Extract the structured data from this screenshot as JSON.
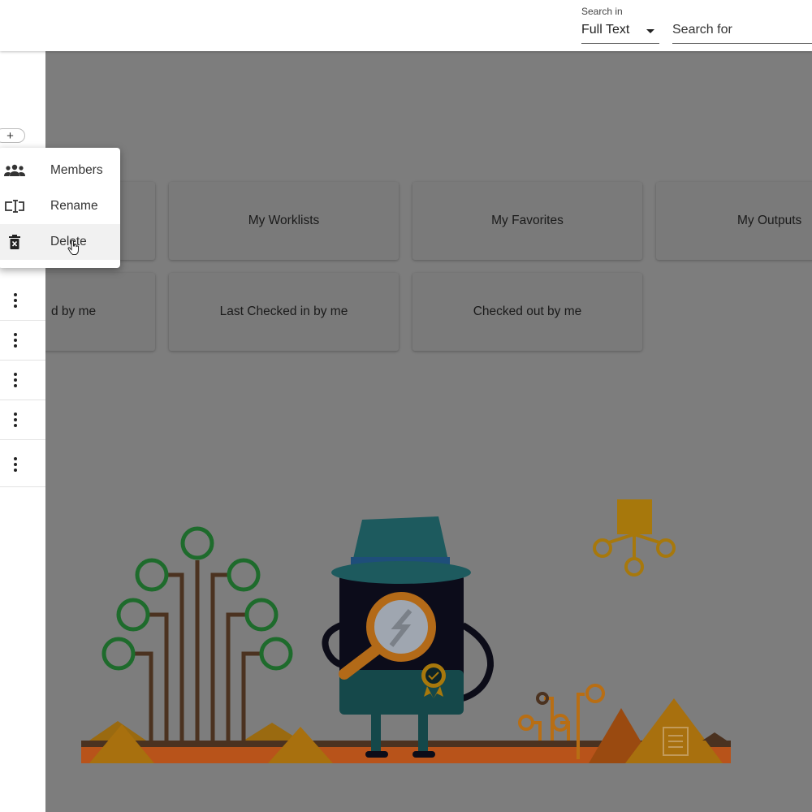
{
  "header": {
    "search_in_label": "Search in",
    "search_in_value": "Full Text",
    "search_for_placeholder": "Search for"
  },
  "sidebar": {
    "add_label": "+",
    "row_count": 5
  },
  "context_menu": {
    "items": [
      {
        "label": "Members",
        "icon": "members-icon"
      },
      {
        "label": "Rename",
        "icon": "rename-icon"
      },
      {
        "label": "Delete",
        "icon": "delete-icon",
        "hovered": true
      }
    ]
  },
  "cards": [
    {
      "label": "My Worklists"
    },
    {
      "label": "My Favorites"
    },
    {
      "label": "My Outputs"
    },
    {
      "label": "d by me"
    },
    {
      "label": "Last Checked in by me"
    },
    {
      "label": "Checked out by me"
    }
  ],
  "colors": {
    "overlay": "#7d7d7d",
    "menu_bg": "#ffffff",
    "tree_green": "#1e6b2c",
    "ground_orange": "#c0611a",
    "hat_teal": "#1d5a5e",
    "accent_gold": "#a7780c"
  }
}
